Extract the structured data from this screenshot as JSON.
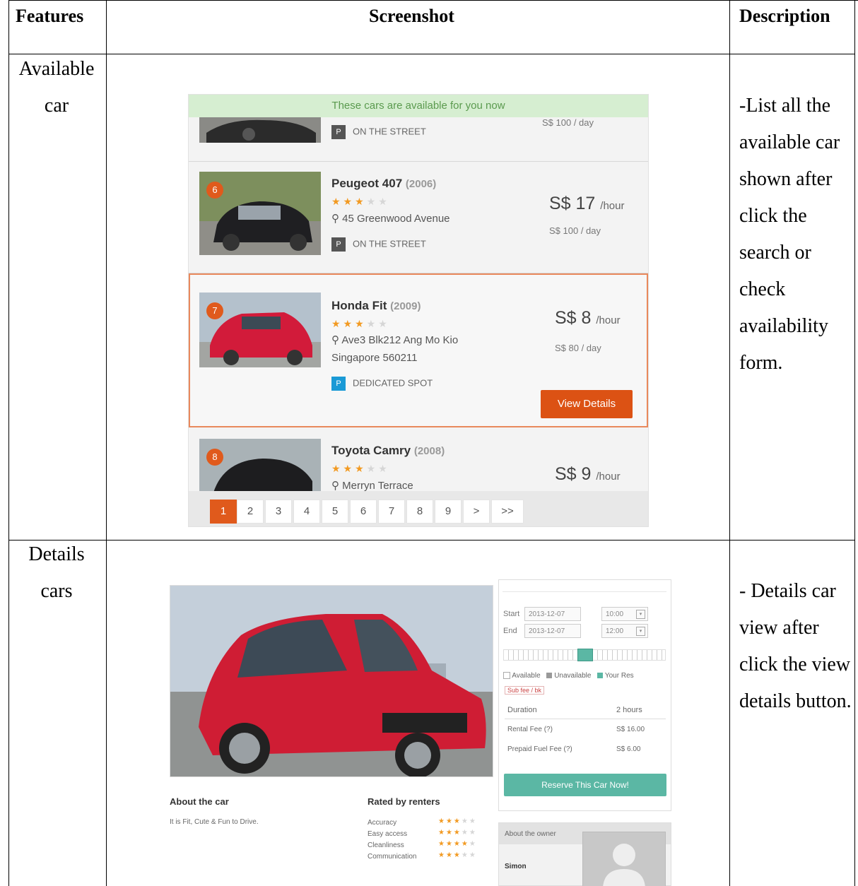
{
  "headers": {
    "features": "Features",
    "screenshot": "Screenshot",
    "description": "Description"
  },
  "rows": [
    {
      "feature": "Available car",
      "description": "-List all the available car shown after click the search or check availability form."
    },
    {
      "feature": "Details cars",
      "description": "- Details car view after click the view details button."
    }
  ],
  "list_ui": {
    "banner": "These cars are available for you now",
    "partial_card": {
      "parking_label": "ON THE STREET",
      "parking_letter": "P",
      "daily": "S$ 100 / day"
    },
    "cars": [
      {
        "rank": "6",
        "name": "Peugeot 407",
        "year": "(2006)",
        "stars": 3,
        "address": "45 Greenwood Avenue",
        "price": "S$ 17",
        "unit": "/hour",
        "daily": "S$ 100 / day",
        "parking_letter": "P",
        "parking_label": "ON THE STREET",
        "parking_color": "#555555"
      },
      {
        "rank": "7",
        "name": "Honda Fit",
        "year": "(2009)",
        "stars": 3,
        "address": "Ave3 Blk212 Ang Mo Kio Singapore 560211",
        "price": "S$ 8",
        "unit": "/hour",
        "daily": "S$ 80 / day",
        "parking_letter": "P",
        "parking_label": "DEDICATED SPOT",
        "parking_color": "#1a9ad6",
        "button": "View Details"
      },
      {
        "rank": "8",
        "name": "Toyota Camry",
        "year": "(2008)",
        "stars": 3,
        "address": "Merryn Terrace",
        "price": "S$ 9",
        "unit": "/hour"
      }
    ],
    "pages": [
      "1",
      "2",
      "3",
      "4",
      "5",
      "6",
      "7",
      "8",
      "9",
      ">",
      ">>"
    ],
    "current_page": "1"
  },
  "details_ui": {
    "start_label": "Start",
    "start_date": "2013-12-07",
    "start_time": "10:00",
    "end_label": "End",
    "end_date": "2013-12-07",
    "end_time": "12:00",
    "legend": {
      "available": "Available",
      "unavailable": "Unavailable",
      "yours": "Your Res"
    },
    "tag": "Sub fee / bk",
    "duration_label": "Duration",
    "duration_value": "2 hours",
    "rental_label": "Rental Fee (?)",
    "rental_value": "S$ 16.00",
    "fuel_label": "Prepaid Fuel Fee (?)",
    "fuel_value": "S$ 6.00",
    "reserve_button": "Reserve This Car Now!",
    "about_car_title": "About the car",
    "about_car_text": "It is Fit, Cute & Fun to Drive.",
    "rated_title": "Rated by renters",
    "ratings": [
      {
        "label": "Accuracy",
        "stars": 3
      },
      {
        "label": "Easy access",
        "stars": 3
      },
      {
        "label": "Cleanliness",
        "stars": 4
      },
      {
        "label": "Communication",
        "stars": 3
      }
    ],
    "owner_title": "About the owner",
    "owner_name": "Simon"
  }
}
